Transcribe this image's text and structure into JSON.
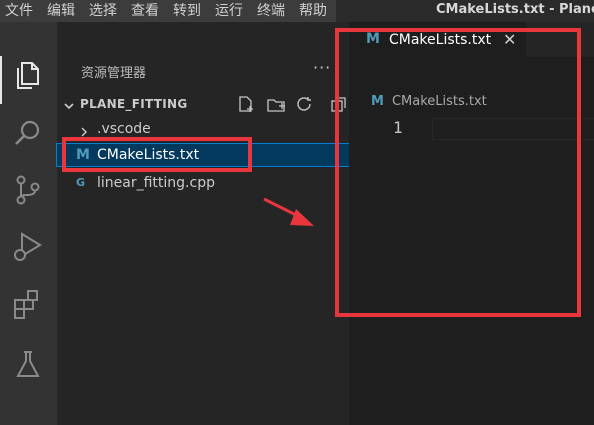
{
  "menubar": {
    "items": [
      "文件",
      "编辑",
      "选择",
      "查看",
      "转到",
      "运行",
      "终端",
      "帮助"
    ],
    "window_title": "CMakeLists.txt - Plane"
  },
  "activitybar": {
    "icons": [
      "explorer-icon",
      "search-icon",
      "source-control-icon",
      "run-debug-icon",
      "extensions-icon",
      "testing-icon"
    ]
  },
  "sidebar": {
    "title": "资源管理器",
    "more": "···",
    "folder": "PLANE_FITTING",
    "items": [
      {
        "label": ".vscode",
        "icon": "chevron-right-icon"
      },
      {
        "label": "CMakeLists.txt",
        "icon": "M"
      },
      {
        "label": "linear_fitting.cpp",
        "icon": "C++"
      }
    ]
  },
  "editor": {
    "tab_label": "CMakeLists.txt",
    "tab_icon": "M",
    "close_glyph": "✕",
    "breadcrumb": "CMakeLists.txt",
    "line_number": "1"
  },
  "colors": {
    "annotation": "#e8363c",
    "selection": "#04395e",
    "cmake_icon": "#519aba",
    "cpp_icon": "#519aba"
  }
}
